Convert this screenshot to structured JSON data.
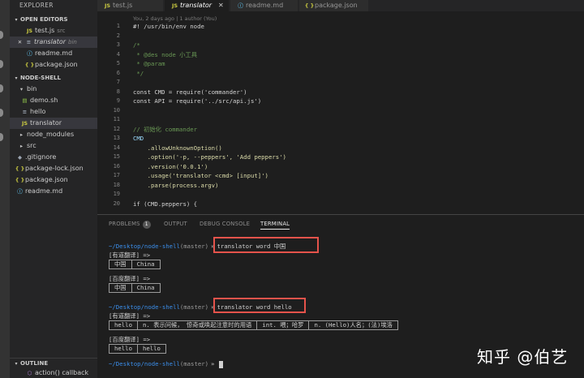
{
  "sidebar": {
    "title": "EXPLORER",
    "open_editors": {
      "heading": "OPEN EDITORS",
      "items": [
        {
          "icon": "JS",
          "label": "test.js",
          "hint": "src"
        },
        {
          "icon": "≡",
          "label": "translator",
          "hint": "bin"
        },
        {
          "icon": "ⓘ",
          "label": "readme.md"
        },
        {
          "icon": "{ }",
          "label": "package.json"
        }
      ]
    },
    "project": {
      "heading": "NODE-SHELL",
      "items": [
        {
          "icon": "v",
          "label": "bin"
        },
        {
          "icon": "▤",
          "label": "demo.sh"
        },
        {
          "icon": "≡",
          "label": "hello"
        },
        {
          "icon": "JS",
          "label": "translator"
        },
        {
          "icon": ">",
          "label": "node_modules"
        },
        {
          "icon": ">",
          "label": "src"
        },
        {
          "icon": "◆",
          "label": ".gitignore"
        },
        {
          "icon": "{ }",
          "label": "package-lock.json"
        },
        {
          "icon": "{ }",
          "label": "package.json"
        },
        {
          "icon": "ⓘ",
          "label": "readme.md"
        }
      ]
    },
    "outline": {
      "heading": "OUTLINE",
      "item": "action() callback"
    }
  },
  "tabs": [
    {
      "icon": "JS",
      "label": "test.js"
    },
    {
      "icon": "JS",
      "label": "translator",
      "close": "✕"
    },
    {
      "icon": "ⓘ",
      "label": "readme.md"
    },
    {
      "icon": "{ }",
      "label": "package.json"
    }
  ],
  "editor": {
    "blame": "You, 2 days ago | 1 author (You)",
    "line_numbers": [
      "1",
      "2",
      "3",
      "4",
      "5",
      "6",
      "7",
      "8",
      "9",
      "10",
      "11",
      "12",
      "13",
      "14",
      "15",
      "16",
      "17",
      "18",
      "19",
      "20"
    ],
    "lines": [
      "#! /usr/bin/env node",
      "",
      "/*",
      " * @des node 小工具",
      " * @param",
      " */",
      "",
      "const CMD = require('commander')",
      "const API = require('../src/api.js')",
      "",
      "",
      "// 初始化 commander",
      "CMD",
      "    .allowUnknownOption()",
      "    .option('-p, --peppers', 'Add peppers')",
      "    .version('0.0.1')",
      "    .usage('translator <cmd> [input]')",
      "    .parse(process.argv)",
      "",
      "if (CMD.peppers) {"
    ]
  },
  "panel": {
    "tabs": {
      "problems": "PROBLEMS",
      "problems_count": "1",
      "output": "OUTPUT",
      "debug_console": "DEBUG CONSOLE",
      "terminal": "TERMINAL"
    }
  },
  "terminal": {
    "path": "~/Desktop/node-shell",
    "branch": "(master)",
    "arrow": "»",
    "cmd1": "translator word 中国",
    "youdao_label": "[有道翻译] =>",
    "baidu_label": "[百度翻译] =>",
    "result1_youdao": [
      "中国",
      "China"
    ],
    "result1_baidu": [
      "中国",
      "China"
    ],
    "cmd2": "translator word hello",
    "result2_youdao": [
      "hello",
      "n. 表示问候， 惊奇或唤起注意时的用语",
      "int. 喂；哈罗",
      "n. (Hello)人名；(法)埃洛"
    ],
    "result2_baidu": [
      "hello",
      "hello"
    ]
  },
  "watermark": "知乎 @伯艺"
}
